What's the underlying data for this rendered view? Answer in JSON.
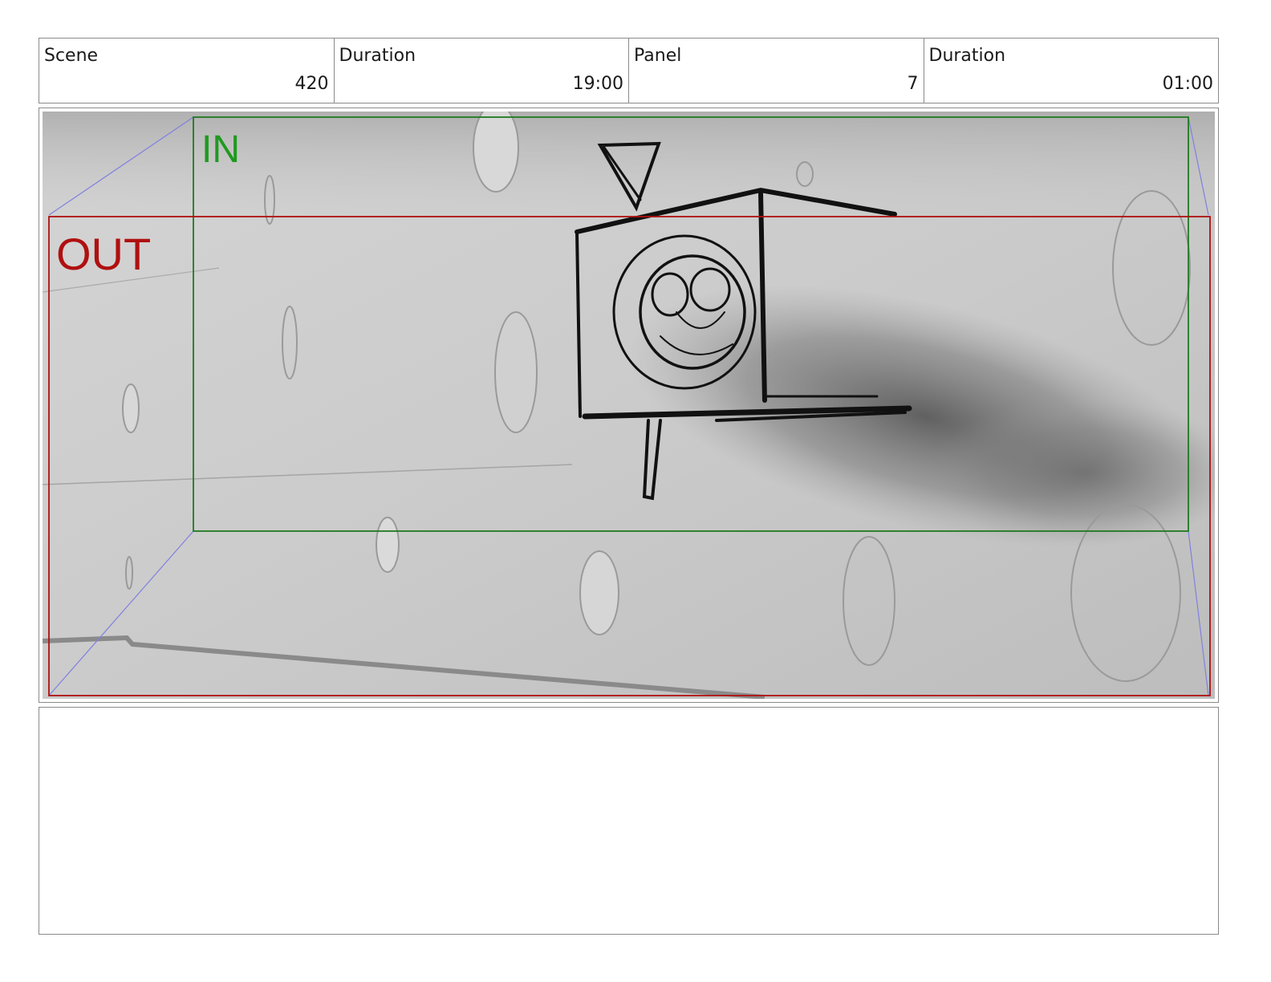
{
  "header": {
    "scene_label": "Scene",
    "scene_value": "420",
    "scene_duration_label": "Duration",
    "scene_duration_value": "19:00",
    "panel_label": "Panel",
    "panel_value": "7",
    "panel_duration_label": "Duration",
    "panel_duration_value": "01:00"
  },
  "frame": {
    "in_label": "IN",
    "out_label": "OUT",
    "in_color": "#1f9a1f",
    "out_color": "#b01010",
    "guide_color": "#8080e0"
  },
  "notes": {
    "text": ""
  }
}
